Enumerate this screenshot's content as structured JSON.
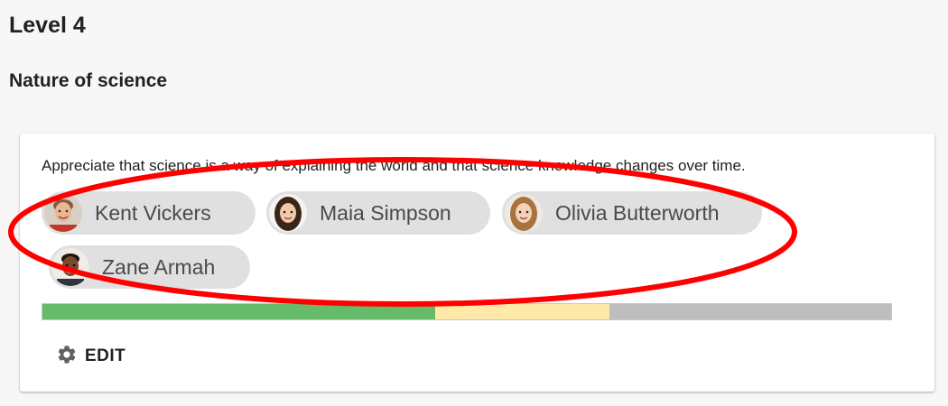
{
  "level": {
    "title": "Level 4"
  },
  "section": {
    "title": "Nature of science"
  },
  "card": {
    "objective": "Appreciate that science is a way of explaining the world and that science knowledge changes over time.",
    "students": [
      {
        "name": "Kent Vickers",
        "avatar": "boy-avatar-icon"
      },
      {
        "name": "Maia Simpson",
        "avatar": "girl-avatar-icon"
      },
      {
        "name": "Olivia Butterworth",
        "avatar": "girl-avatar-icon"
      },
      {
        "name": "Zane Armah",
        "avatar": "boy-avatar-icon"
      }
    ],
    "progress": {
      "segments": [
        {
          "status": "achieved",
          "fraction": 0.463,
          "color": "#66bb6a"
        },
        {
          "status": "working-towards",
          "fraction": 0.205,
          "color": "#ffe9a8"
        },
        {
          "status": "not-started",
          "fraction": 0.332,
          "color": "#bdbdbd"
        }
      ]
    },
    "edit_label": "EDIT",
    "edit_icon": "gear-icon"
  },
  "annotation": {
    "shape": "ellipse",
    "color": "#ff0000"
  }
}
